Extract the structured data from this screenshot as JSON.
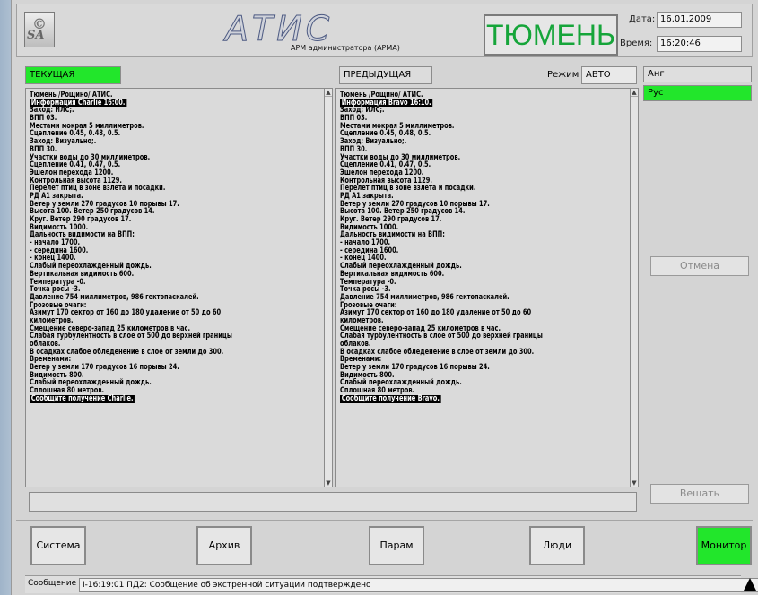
{
  "header": {
    "logo_text": "SA",
    "app_title": "АТИС",
    "app_subtitle": "АРМ администратора (АРМА)",
    "city": "ТЮМЕНЬ",
    "date_label": "Дата:",
    "date_value": "16.01.2009",
    "time_label": "Время:",
    "time_value": "16:20:46"
  },
  "current": {
    "label": "ТЕКУЩАЯ",
    "lines": [
      "Тюмень /Рощино/ АТИС.",
      "Информация Charlie 16:00.",
      "Заход: ИЛС;.",
      "ВПП 03.",
      "Местами мокрая 5 миллиметров.",
      "Сцепление 0.45, 0.48, 0.5.",
      "Заход: Визуально;.",
      "ВПП 30.",
      "Участки воды до 30 миллиметров.",
      "Сцепление 0.41, 0.47, 0.5.",
      "Эшелон перехода 1200.",
      "Контрольная высота 1129.",
      "Перелет птиц в зоне взлета и посадки.",
      "РД А1 закрыта.",
      "Ветер у земли 270 градусов 10 порывы 17.",
      "Высота 100. Ветер 250 градусов 14.",
      "Круг. Ветер 290 градусов 17.",
      "Видимость 1000.",
      "Дальность видимости на ВПП:",
      "- начало 1700.",
      "- середина 1600.",
      "- конец 1400.",
      "Слабый переохлажденный дождь.",
      "Вертикальная видимость 600.",
      "Температура -0.",
      "Точка росы -3.",
      "Давление 754 миллиметров, 986 гектопаскалей.",
      "Грозовые очаги:",
      "Азимут 170 сектор от 160 до 180 удаление от 50 до 60",
      "километров.",
      "Смещение северо-запад 25 километров в час.",
      "Слабая турбулентность в слое от 500 до верхней границы",
      "облаков.",
      "В осадках слабое обледенение в слое от земли до 300.",
      "Временами:",
      "Ветер у земли 170 градусов 16 порывы 24.",
      "Видимость 800.",
      "Слабый переохлажденный дождь.",
      "Сплошная 80 метров.",
      "Сообщите получение Charlie."
    ]
  },
  "previous": {
    "label": "ПРЕДЫДУЩАЯ",
    "mode_label": "Режим",
    "mode_value": "АВТО",
    "lines": [
      "Тюмень /Рощино/ АТИС.",
      "Информация Bravo 16:10.",
      "Заход: ИЛС;.",
      "ВПП 03.",
      "Местами мокрая 5 миллиметров.",
      "Сцепление 0.45, 0.48, 0.5.",
      "Заход: Визуально;.",
      "ВПП 30.",
      "Участки воды до 30 миллиметров.",
      "Сцепление 0.41, 0.47, 0.5.",
      "Эшелон перехода 1200.",
      "Контрольная высота 1129.",
      "Перелет птиц в зоне взлета и посадки.",
      "РД А1 закрыта.",
      "Ветер у земли 270 градусов 10 порывы 17.",
      "Высота 100. Ветер 250 градусов 14.",
      "Круг. Ветер 290 градусов 17.",
      "Видимость 1000.",
      "Дальность видимости на ВПП:",
      "- начало 1700.",
      "- середина 1600.",
      "- конец 1400.",
      "Слабый переохлажденный дождь.",
      "Вертикальная видимость 600.",
      "Температура -0.",
      "Точка росы -3.",
      "Давление 754 миллиметров, 986 гектопаскалей.",
      "Грозовые очаги:",
      "Азимут 170 сектор от 160 до 180 удаление от 50 до 60",
      "километров.",
      "Смещение северо-запад 25 километров в час.",
      "Слабая турбулентность в слое от 500 до верхней границы",
      "облаков.",
      "В осадках слабое обледенение в слое от земли до 300.",
      "Временами:",
      "Ветер у земли 170 градусов 16 порывы 24.",
      "Видимость 800.",
      "Слабый переохлажденный дождь.",
      "Сплошная 80 метров.",
      "Сообщите получение Bravo."
    ]
  },
  "languages": [
    {
      "label": "Анг",
      "active": false
    },
    {
      "label": "Рус",
      "active": true
    }
  ],
  "side_buttons": {
    "cancel": "Отмена",
    "broadcast": "Вещать"
  },
  "footer_buttons": {
    "system": "Система",
    "archive": "Архив",
    "params": "Парам",
    "people": "Люди",
    "monitor": "Монитор"
  },
  "message_bar": {
    "label": "Сообщение",
    "text": "I-16:19:01 ПД2: Сообщение об экстренной ситуации подтверждено"
  },
  "colors": {
    "active_green": "#22e62b",
    "city_green": "#16a53a"
  }
}
